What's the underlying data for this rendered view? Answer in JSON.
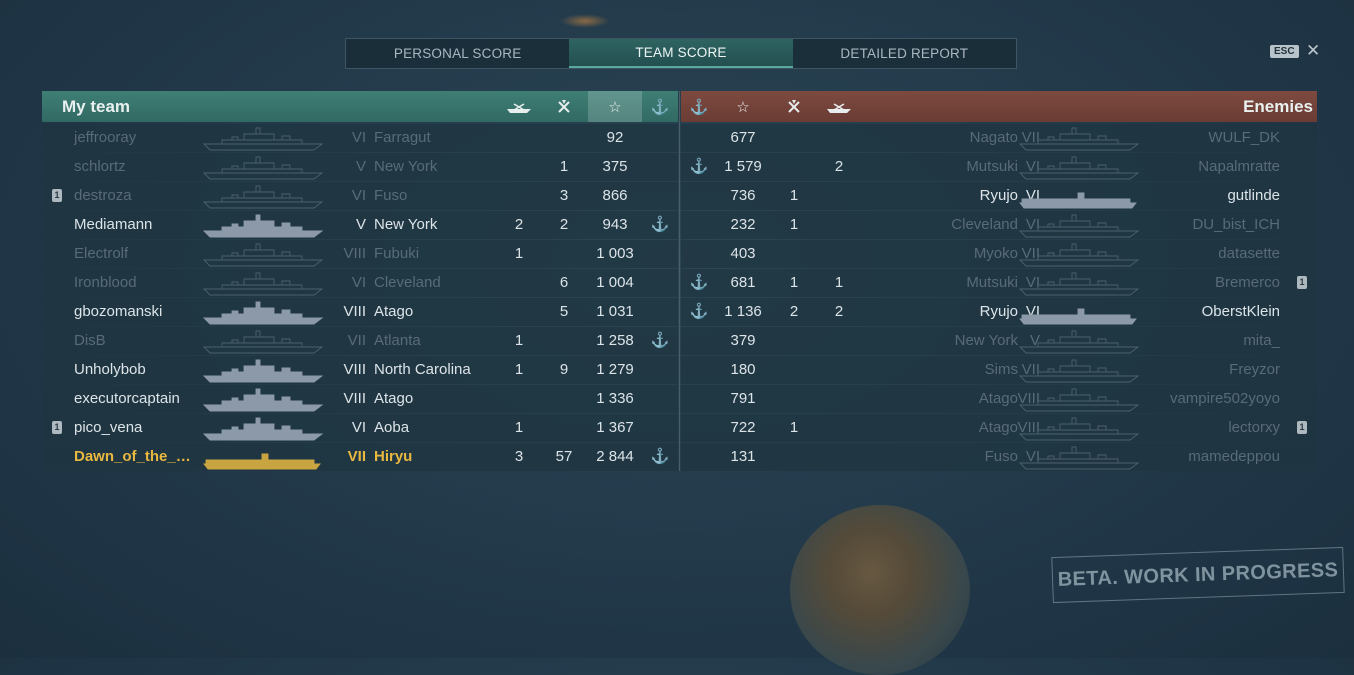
{
  "tabs": [
    {
      "label": "PERSONAL SCORE",
      "active": false
    },
    {
      "label": "TEAM SCORE",
      "active": true
    },
    {
      "label": "DETAILED REPORT",
      "active": false
    }
  ],
  "esc_label": "ESC",
  "close_label": "✕",
  "my_team": {
    "title": "My team",
    "columns": [
      "ships-destroyed-icon",
      "planes-destroyed-icon",
      "base-xp-star-icon",
      "anchor-alive-icon"
    ],
    "rows": [
      {
        "name": "jeffrooray",
        "tier": "VI",
        "ship": "Farragut",
        "c1": "",
        "c2": "",
        "score": "92",
        "alive": false,
        "badge": false,
        "player": false
      },
      {
        "name": "schlortz",
        "tier": "V",
        "ship": "New York",
        "c1": "",
        "c2": "1",
        "score": "375",
        "alive": false,
        "badge": false,
        "player": false
      },
      {
        "name": "destroza",
        "tier": "VI",
        "ship": "Fuso",
        "c1": "",
        "c2": "3",
        "score": "866",
        "alive": false,
        "badge": true,
        "player": false
      },
      {
        "name": "Mediamann",
        "tier": "V",
        "ship": "New York",
        "c1": "2",
        "c2": "2",
        "score": "943",
        "alive": true,
        "badge": false,
        "player": false
      },
      {
        "name": "Electrolf",
        "tier": "VIII",
        "ship": "Fubuki",
        "c1": "1",
        "c2": "",
        "score": "1 003",
        "alive": false,
        "badge": false,
        "player": false
      },
      {
        "name": "Ironblood",
        "tier": "VI",
        "ship": "Cleveland",
        "c1": "",
        "c2": "6",
        "score": "1 004",
        "alive": false,
        "badge": false,
        "player": false
      },
      {
        "name": "gbozomanski",
        "tier": "VIII",
        "ship": "Atago",
        "c1": "",
        "c2": "5",
        "score": "1 031",
        "alive": true,
        "badge": false,
        "player": false
      },
      {
        "name": "DisB",
        "tier": "VII",
        "ship": "Atlanta",
        "c1": "1",
        "c2": "",
        "score": "1 258",
        "alive": false,
        "badge": false,
        "player": false
      },
      {
        "name": "Unholybob",
        "tier": "VIII",
        "ship": "North Carolina",
        "c1": "1",
        "c2": "9",
        "score": "1 279",
        "alive": true,
        "badge": false,
        "player": false
      },
      {
        "name": "executorcaptain",
        "tier": "VIII",
        "ship": "Atago",
        "c1": "",
        "c2": "",
        "score": "1 336",
        "alive": true,
        "badge": false,
        "player": false
      },
      {
        "name": "pico_vena",
        "tier": "VI",
        "ship": "Aoba",
        "c1": "1",
        "c2": "",
        "score": "1 367",
        "alive": true,
        "badge": true,
        "player": false
      },
      {
        "name": "Dawn_of_the_Po...",
        "tier": "VII",
        "ship": "Hiryu",
        "c1": "3",
        "c2": "57",
        "score": "2 844",
        "alive": false,
        "badge": false,
        "player": true
      }
    ],
    "anchors": [
      false,
      false,
      false,
      true,
      false,
      false,
      false,
      true,
      false,
      false,
      false,
      true
    ]
  },
  "enemies": {
    "title": "Enemies",
    "rows": [
      {
        "name": "WULF_DK",
        "tier": "VII",
        "ship": "Nagato",
        "c1": "",
        "c2": "",
        "score": "677",
        "alive": false,
        "anchor": false,
        "badge": false
      },
      {
        "name": "Napalmratte",
        "tier": "VI",
        "ship": "Mutsuki",
        "c1": "2",
        "c2": "",
        "score": "1 579",
        "alive": false,
        "anchor": true,
        "badge": false
      },
      {
        "name": "gutlinde",
        "tier": "VI",
        "ship": "Ryujo",
        "c1": "",
        "c2": "1",
        "score": "736",
        "alive": true,
        "anchor": false,
        "badge": false
      },
      {
        "name": "DU_bist_ICH",
        "tier": "VI",
        "ship": "Cleveland",
        "c1": "",
        "c2": "1",
        "score": "232",
        "alive": false,
        "anchor": false,
        "badge": false
      },
      {
        "name": "datasette",
        "tier": "VII",
        "ship": "Myoko",
        "c1": "",
        "c2": "",
        "score": "403",
        "alive": false,
        "anchor": false,
        "badge": false
      },
      {
        "name": "Bremerco",
        "tier": "VI",
        "ship": "Mutsuki",
        "c1": "1",
        "c2": "1",
        "score": "681",
        "alive": false,
        "anchor": true,
        "badge": true
      },
      {
        "name": "OberstKlein",
        "tier": "VI",
        "ship": "Ryujo",
        "c1": "2",
        "c2": "2",
        "score": "1 136",
        "alive": true,
        "anchor": true,
        "badge": false
      },
      {
        "name": "mita_",
        "tier": "V",
        "ship": "New York",
        "c1": "",
        "c2": "",
        "score": "379",
        "alive": false,
        "anchor": false,
        "badge": false
      },
      {
        "name": "Freyzor",
        "tier": "VII",
        "ship": "Sims",
        "c1": "",
        "c2": "",
        "score": "180",
        "alive": false,
        "anchor": false,
        "badge": false
      },
      {
        "name": "vampire502yoyo",
        "tier": "VIII",
        "ship": "Atago",
        "c1": "",
        "c2": "",
        "score": "791",
        "alive": false,
        "anchor": false,
        "badge": false
      },
      {
        "name": "lectorxy",
        "tier": "VIII",
        "ship": "Atago",
        "c1": "",
        "c2": "1",
        "score": "722",
        "alive": false,
        "anchor": false,
        "badge": true
      },
      {
        "name": "mamedeppou",
        "tier": "VI",
        "ship": "Fuso",
        "c1": "",
        "c2": "",
        "score": "131",
        "alive": false,
        "anchor": false,
        "badge": false
      }
    ]
  },
  "icons": {
    "anchor": "⚓",
    "star": "☆",
    "planes": "✈",
    "ship": "ship-silhouette"
  },
  "colors": {
    "my_team_header": "#3f7f75",
    "enemy_header": "#7d4a40",
    "player_highlight": "#e8b840",
    "anchor": "#c99a35"
  },
  "watermark": "BETA. WORK IN PROGRESS"
}
